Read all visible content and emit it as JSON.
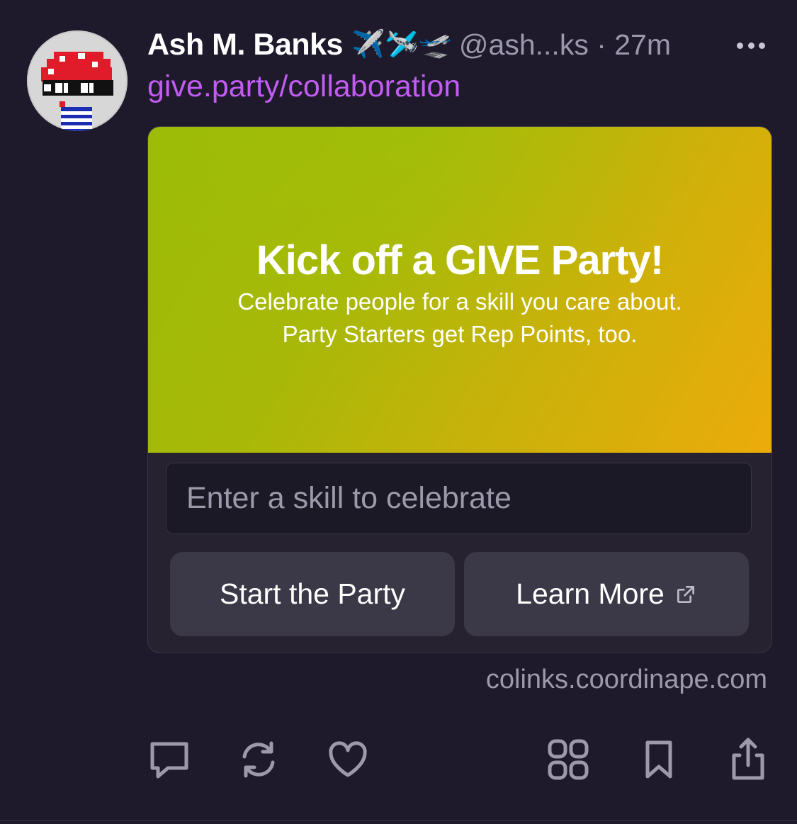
{
  "post": {
    "author_name": "Ash M. Banks",
    "author_emoji": "✈️🛩️🛫",
    "handle_time": "@ash...ks · 27m",
    "link_text": "give.party/collaboration"
  },
  "card": {
    "hero_title": "Kick off a GIVE Party!",
    "hero_sub_line1": "Celebrate people for a skill you care about.",
    "hero_sub_line2": "Party Starters get Rep Points, too.",
    "input_placeholder": "Enter a skill to celebrate",
    "start_button": "Start the Party",
    "learn_button": "Learn More",
    "domain": "colinks.coordinape.com"
  },
  "colors": {
    "background": "#1e1a2c",
    "link": "#c25cf2",
    "button": "#3b3847",
    "muted": "#9c99ab",
    "gradient_start": "#9bbc07",
    "gradient_end": "#ecab0a"
  },
  "icons": {
    "avatar": "pixel-mushroom-sunglasses-avatar",
    "more": "more-horizontal-icon",
    "external_link": "external-link-icon",
    "actions": [
      "comment-icon",
      "recast-icon",
      "like-icon",
      "apps-icon",
      "bookmark-icon",
      "share-icon"
    ]
  }
}
